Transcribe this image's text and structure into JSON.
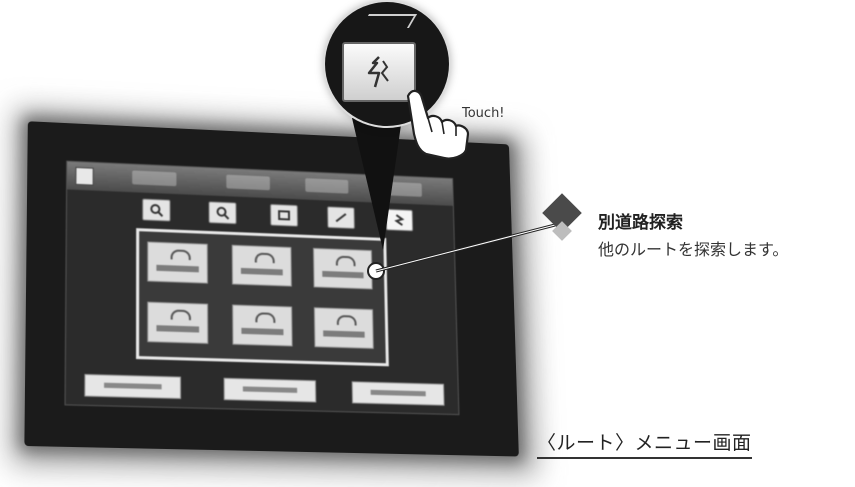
{
  "touch_label": "Touch!",
  "callout": {
    "title": "別道路探索",
    "description": "他のルートを探索します。"
  },
  "caption": "〈ルート〉メニュー画面",
  "colors": {
    "screen_bezel": "#1b1b1b",
    "button_face": "#dcdcdc",
    "callout_line": "#222222"
  },
  "icons": [
    "home-icon",
    "search-icon",
    "route-icon",
    "detour-icon",
    "touch-hand-icon"
  ]
}
